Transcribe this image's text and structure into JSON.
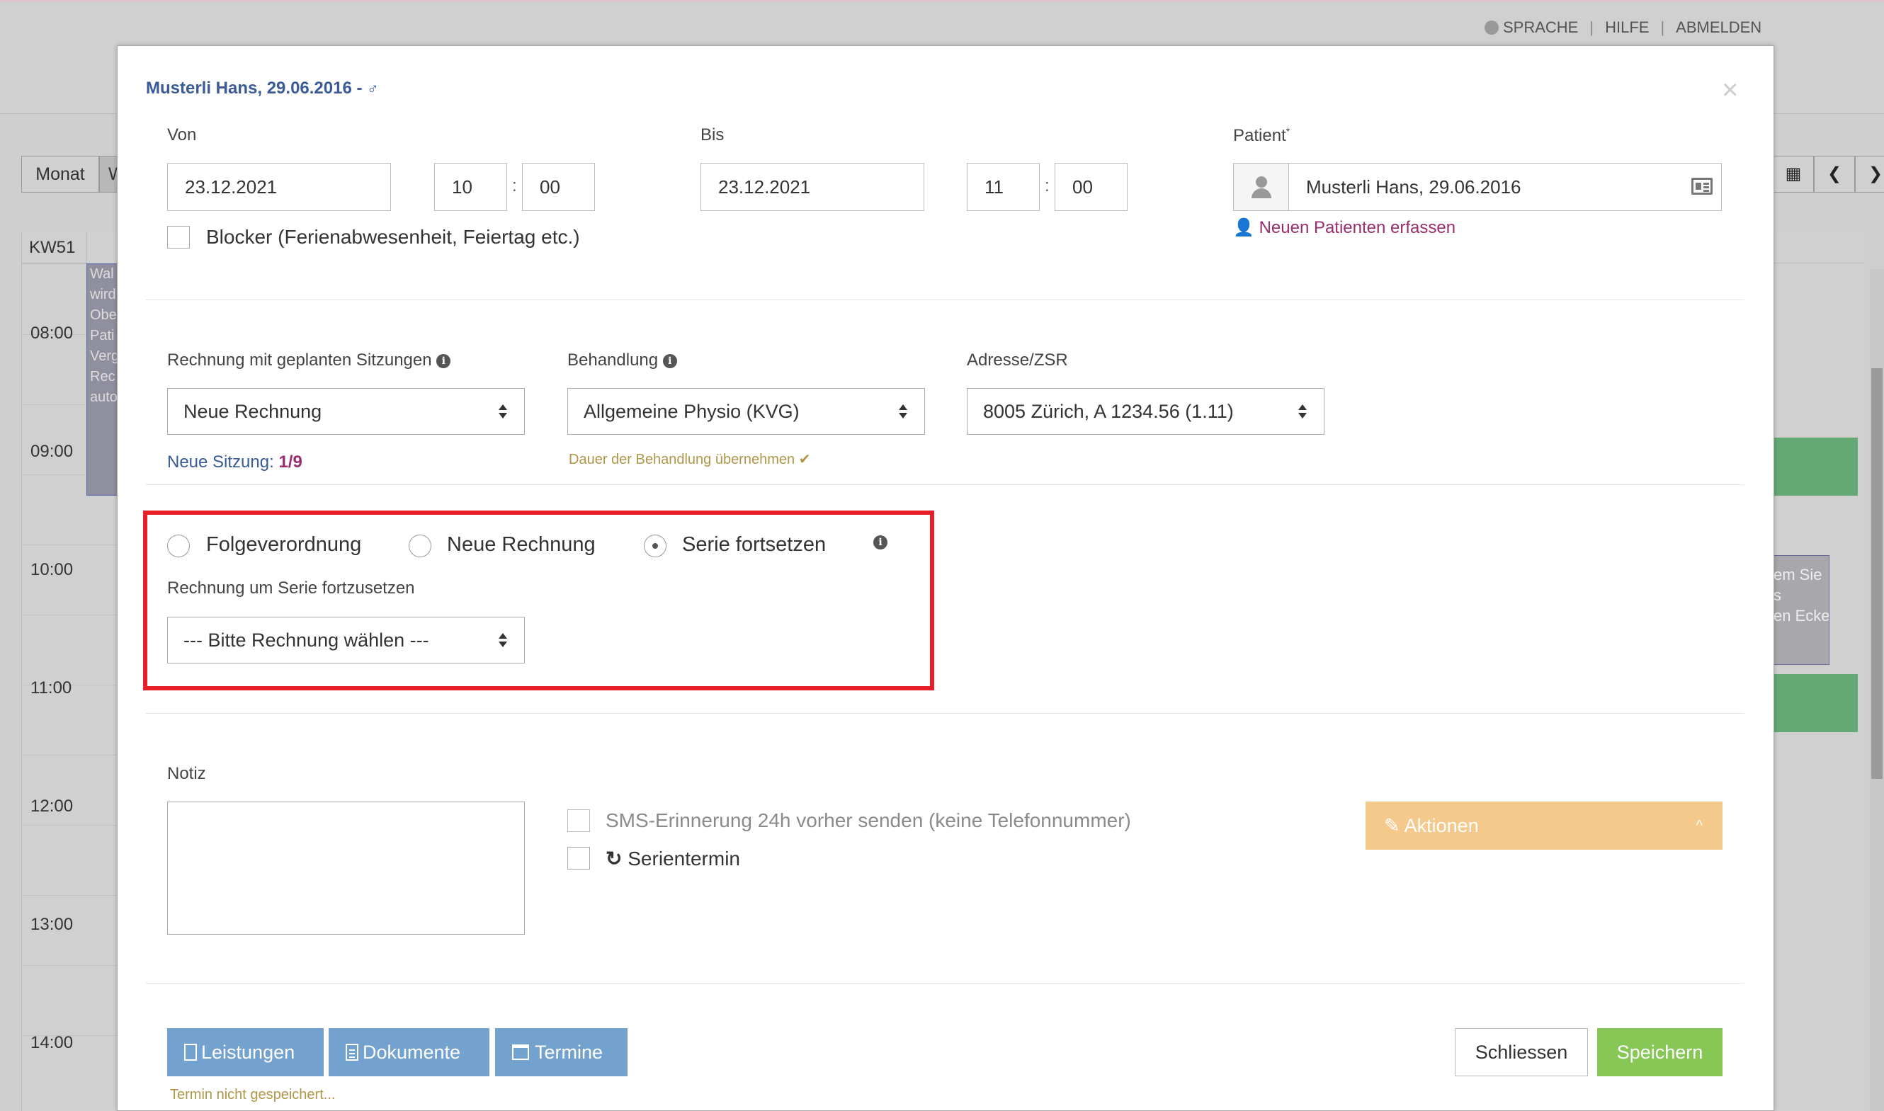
{
  "topnav": {
    "sprache": "SPRACHE",
    "hilfe": "HILFE",
    "abmelden": "ABMELDEN",
    "separator": "|"
  },
  "calendar": {
    "view_month": "Monat",
    "view_week_partial": "W",
    "week_label": "KW51",
    "hours": [
      "08:00",
      "09:00",
      "10:00",
      "11:00",
      "12:00",
      "13:00",
      "14:00"
    ],
    "left_event_text": [
      "Wal",
      "wird",
      "Obe",
      "Pati",
      "Verg",
      "Rec",
      "auto"
    ],
    "right_event_text": [
      "em Sie",
      "s",
      "en Ecke"
    ]
  },
  "modal": {
    "title": "Musterli Hans, 29.06.2016 -",
    "close": "×",
    "von_label": "Von",
    "von_date": "23.12.2021",
    "von_hour": "10",
    "von_min": "00",
    "bis_label": "Bis",
    "bis_date": "23.12.2021",
    "bis_hour": "11",
    "bis_min": "00",
    "time_sep": ":",
    "blocker_label": "Blocker (Ferienabwesenheit, Feiertag etc.)",
    "patient_label": "Patient",
    "patient_required": "*",
    "patient_value": "Musterli Hans, 29.06.2016",
    "new_patient_link": "Neuen Patienten erfassen",
    "rechnung_label": "Rechnung mit geplanten Sitzungen",
    "rechnung_value": "Neue Rechnung",
    "behandlung_label": "Behandlung",
    "behandlung_value": "Allgemeine Physio (KVG)",
    "adresse_label": "Adresse/ZSR",
    "adresse_value": "8005 Zürich, A 1234.56 (1.11)",
    "neue_sitzung_label": "Neue Sitzung:",
    "neue_sitzung_value": "1/9",
    "dauer_link": "Dauer der Behandlung übernehmen",
    "radio_folge": "Folgeverordnung",
    "radio_neue": "Neue Rechnung",
    "radio_serie": "Serie fortsetzen",
    "serie_label": "Rechnung um Serie fortzusetzen",
    "serie_select": "--- Bitte Rechnung wählen ---",
    "notiz_label": "Notiz",
    "sms_label": "SMS-Erinnerung 24h vorher senden (keine Telefonnummer)",
    "serientermin_label": "Serientermin",
    "aktionen_label": "Aktionen",
    "btn_leistungen": "Leistungen",
    "btn_dokumente": "Dokumente",
    "btn_termine": "Termine",
    "status_text": "Termin nicht gespeichert...",
    "btn_schliessen": "Schliessen",
    "btn_speichern": "Speichern"
  },
  "colors": {
    "title_blue": "#3a5a98",
    "link_purple": "#9b2d6e",
    "highlight_red": "#e8202a",
    "aktionen_orange": "#f5c88c",
    "button_blue": "#74a2cf",
    "save_green": "#86c756"
  }
}
